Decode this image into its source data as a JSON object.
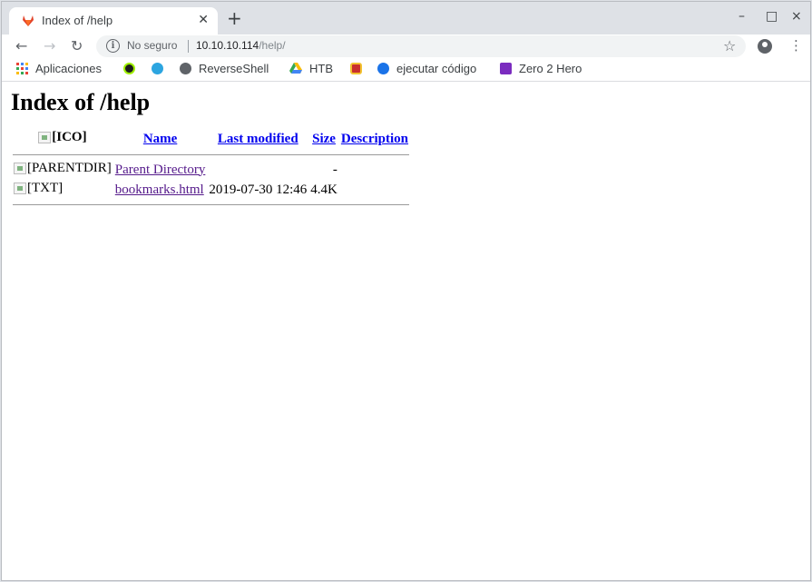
{
  "tab": {
    "title": "Index of /help"
  },
  "window_controls": {
    "minimize": "–",
    "maximize": "□",
    "close": "×"
  },
  "omnibox": {
    "security_label": "No seguro",
    "host": "10.10.10.114",
    "path": "/help/"
  },
  "bookmarks": [
    {
      "label": "Aplicaciones",
      "icon": "apps-grid-icon"
    },
    {
      "label": "",
      "icon": "htb-icon-1"
    },
    {
      "label": "",
      "icon": "telegram-icon"
    },
    {
      "label": "ReverseShell",
      "icon": "reverseshell-icon"
    },
    {
      "label": "HTB",
      "icon": "drive-icon"
    },
    {
      "label": "",
      "icon": "ironman-icon"
    },
    {
      "label": "ejecutar código",
      "icon": "ejecutar-icon"
    },
    {
      "label": "Zero 2 Hero",
      "icon": "zero2hero-icon"
    }
  ],
  "page": {
    "heading": "Index of /help",
    "columns": {
      "icon_alt": "[ICO]",
      "name": "Name",
      "last_modified": "Last modified",
      "size": "Size",
      "description": "Description"
    },
    "rows": [
      {
        "icon_alt": "[PARENTDIR]",
        "name": "Parent Directory",
        "last_modified": "",
        "size": "-",
        "description": ""
      },
      {
        "icon_alt": "[TXT]",
        "name": "bookmarks.html",
        "last_modified": "2019-07-30 12:46",
        "size": "4.4K",
        "description": ""
      }
    ]
  },
  "colors": {
    "link": "#0000ee",
    "visited_link": "#551a8b",
    "tabstrip_bg": "#dee1e6"
  }
}
